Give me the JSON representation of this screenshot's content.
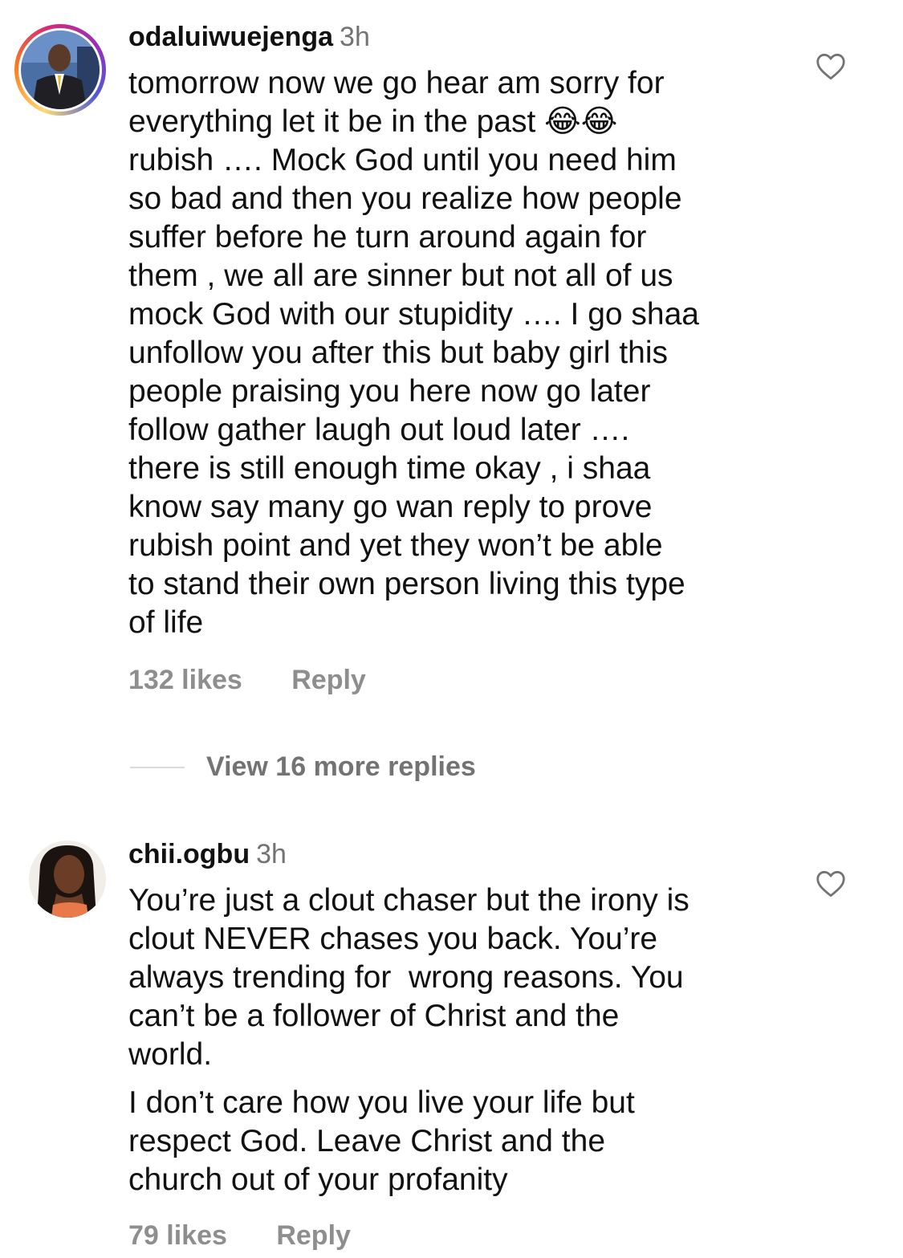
{
  "comments": [
    {
      "username": "odaluiwuejenga",
      "time": "3h",
      "text": "tomorrow now we go hear am sorry for\neverything let it be in the past 😂😂\nrubish …. Mock God until you need him\nso bad and then you realize how people\nsuffer before he turn around again for\nthem , we all are sinner but not all of us\nmock God with our stupidity …. I go shaa\nunfollow you after this but baby girl this\npeople praising you here now go later\nfollow gather laugh out loud later ….\nthere is still enough time okay , i shaa\nknow say many go wan reply to prove\nrubish point and yet they won’t be able\nto stand their own person living this type\nof life",
      "likes": "132 likes",
      "reply_label": "Reply",
      "like_icon": "heart-outline-icon",
      "view_replies": "View 16 more replies"
    },
    {
      "username": "chii.ogbu",
      "time": "3h",
      "text": "You’re just a clout chaser but the irony is\nclout NEVER chases you back. You’re\nalways trending for  wrong reasons. You\ncan’t be a follower of Christ and the\nworld.",
      "text2": "I don’t care how you live your life but\nrespect God. Leave Christ and the\nchurch out of your profanity",
      "likes": "79 likes",
      "reply_label": "Reply",
      "like_icon": "heart-outline-icon"
    }
  ],
  "colors": {
    "primary_text": "#111111",
    "secondary_text": "#737373",
    "meta_text": "#8e8e8e",
    "divider": "#dbdbdb"
  }
}
